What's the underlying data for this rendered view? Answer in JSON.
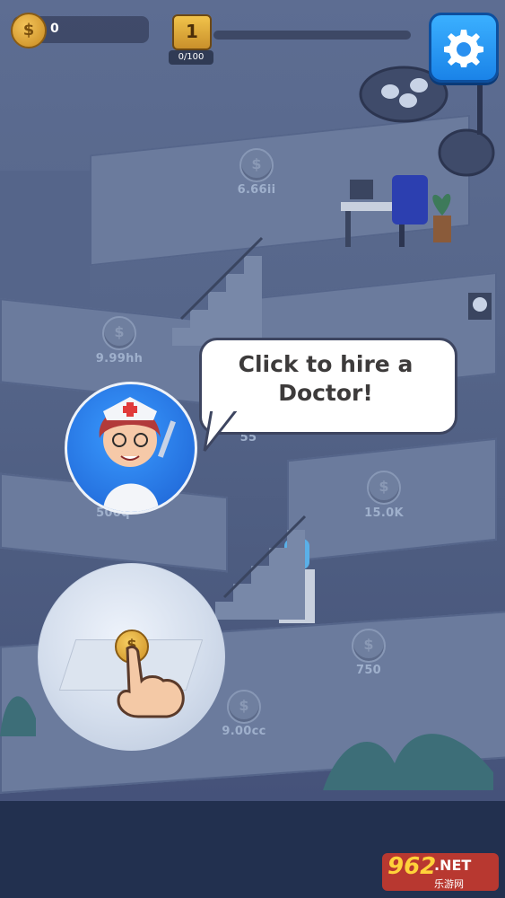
{
  "hud": {
    "coin_symbol": "$",
    "coin_count": "0",
    "level": "1",
    "progress_text": "0/100",
    "progress_fraction": 0.0
  },
  "settings": {
    "icon": "gear-icon"
  },
  "floor_prices": [
    "6.66ii",
    "9.99hh",
    "55",
    "500q",
    "15.0K",
    "750",
    "9.00cc"
  ],
  "tutorial": {
    "message": "Click to hire a Doctor!",
    "coin_symbol": "$"
  },
  "watermark": {
    "number": "962",
    "suffix": ".NET",
    "subtitle": "乐游网"
  },
  "colors": {
    "accent_blue": "#1a83e8",
    "coin_gold": "#f2c54a",
    "scene_bg": "#56668a",
    "bottom_bar": "#22304f"
  }
}
